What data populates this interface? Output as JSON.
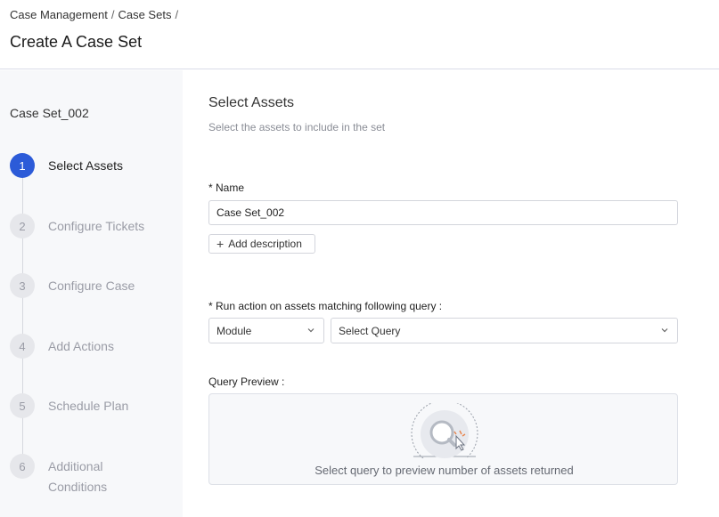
{
  "header": {
    "breadcrumb": [
      "Case Management",
      "Case Sets"
    ],
    "breadcrumb_separator": "/",
    "title": "Create A Case Set"
  },
  "sidebar": {
    "set_name": "Case Set_002",
    "steps": [
      {
        "number": "1",
        "label": "Select Assets",
        "active": true
      },
      {
        "number": "2",
        "label": "Configure Tickets",
        "active": false
      },
      {
        "number": "3",
        "label": "Configure Case",
        "active": false
      },
      {
        "number": "4",
        "label": "Add Actions",
        "active": false
      },
      {
        "number": "5",
        "label": "Schedule Plan",
        "active": false
      },
      {
        "number": "6",
        "label": "Additional",
        "label_line2": "Conditions",
        "active": false
      }
    ]
  },
  "main": {
    "section_title": "Select Assets",
    "section_subtitle": "Select the assets to include in the set",
    "name_label": "* Name",
    "name_value": "Case Set_002",
    "add_description": "Add description",
    "query_label": "* Run action on assets matching following query :",
    "module_select": "Module",
    "query_select": "Select Query",
    "preview_label": "Query Preview :",
    "preview_text": "Select query to preview number of assets returned"
  },
  "colors": {
    "accent": "#2c5bd8",
    "sidebar_bg": "#f7f8fa",
    "inactive_step": "#9a9ca6"
  }
}
